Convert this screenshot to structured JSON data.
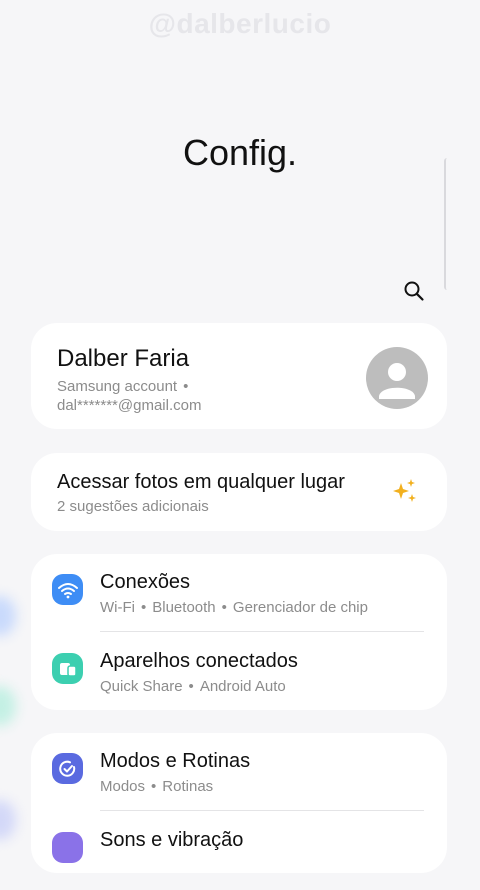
{
  "watermark": "@dalberlucio",
  "header": {
    "title": "Config.",
    "search_icon": "search-icon"
  },
  "account": {
    "name": "Dalber Faria",
    "subtitle_service": "Samsung account",
    "subtitle_email": "dal*******@gmail.com"
  },
  "suggestion": {
    "title": "Acessar fotos em qualquer lugar",
    "subtitle": "2 sugestões adicionais",
    "icon": "sparkle-icon"
  },
  "settings": [
    {
      "title": "Conexões",
      "items": [
        "Wi-Fi",
        "Bluetooth",
        "Gerenciador de chip"
      ],
      "icon": "wifi-icon",
      "color": "#3e8df5"
    },
    {
      "title": "Aparelhos conectados",
      "items": [
        "Quick Share",
        "Android Auto"
      ],
      "icon": "devices-icon",
      "color": "#3ccfb0"
    },
    {
      "title": "Modos e Rotinas",
      "items": [
        "Modos",
        "Rotinas"
      ],
      "icon": "modes-icon",
      "color": "#5a6ae0"
    },
    {
      "title": "Sons e vibração",
      "items": [],
      "icon": "sound-icon",
      "color": "#8a72e8"
    }
  ],
  "colors": {
    "background": "#f6f6f8",
    "card": "#ffffff",
    "accent_blue": "#3e8df5",
    "accent_teal": "#3ccfb0",
    "accent_indigo": "#5a6ae0",
    "sparkle": "#f2b01e"
  }
}
